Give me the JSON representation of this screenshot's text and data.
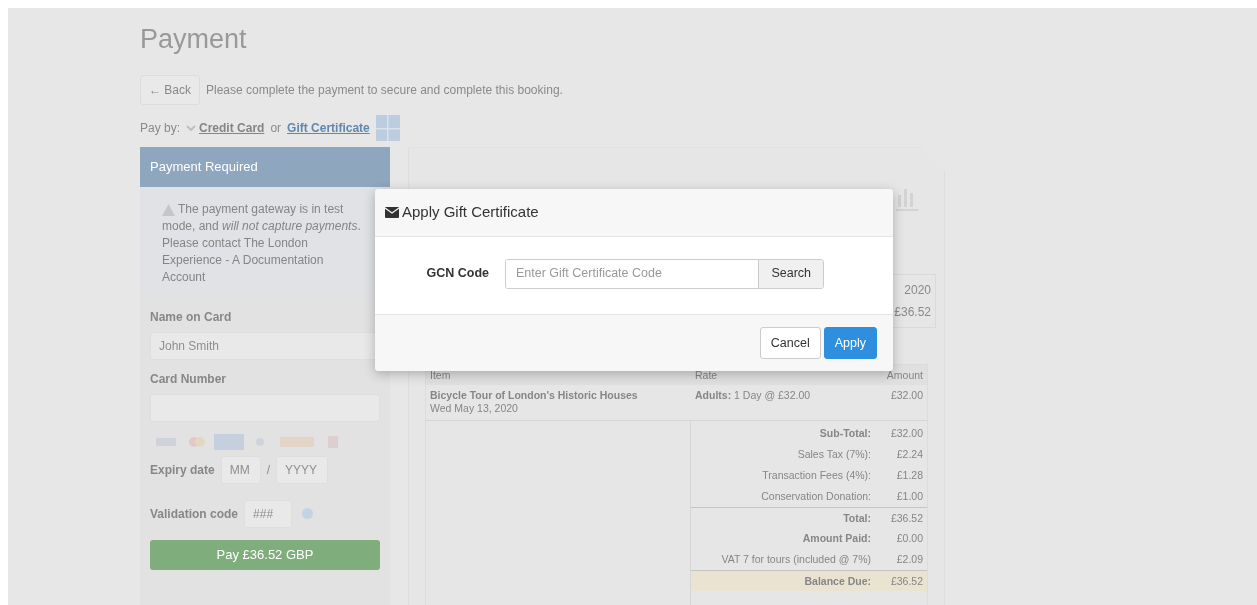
{
  "page": {
    "title": "Payment",
    "back_button": "← Back",
    "intro": "Please complete the payment to secure and complete this booking."
  },
  "pay_by": {
    "label": "Pay by:",
    "separator": "or",
    "options": [
      {
        "label": "Credit Card",
        "selected": true
      },
      {
        "label": "Gift Certificate",
        "selected": false
      }
    ]
  },
  "payment_panel": {
    "header": "Payment Required",
    "notice": "The payment gateway is in test mode, and *will not capture payments*. Please contact The London Experience - A Documentation Account",
    "name_on_card": {
      "label": "Name on Card",
      "placeholder": "John Smith"
    },
    "card_number": {
      "label": "Card Number"
    },
    "expiry": {
      "label": "Expiry date",
      "month_placeholder": "MM",
      "separator": "/",
      "year_placeholder": "YYYY"
    },
    "validation": {
      "label": "Validation code",
      "placeholder": "###"
    },
    "pay_button": "Pay £36.52 GBP"
  },
  "invoice": {
    "meta": [
      "2020",
      "£36.52"
    ],
    "table": {
      "columns": [
        "Item",
        "Rate",
        "Amount"
      ],
      "rows": [
        {
          "item": "Bicycle Tour of London's Historic Houses",
          "date": "Wed May 13, 2020",
          "rate_label": "Adults:",
          "rate": "1 Day @ £32.00",
          "amount": "£32.00"
        }
      ]
    },
    "totals": [
      {
        "label": "Sub-Total:",
        "value": "£32.00",
        "bold": true,
        "divider_before": false,
        "highlight": false
      },
      {
        "label": "Sales Tax (7%):",
        "value": "£2.24",
        "bold": false,
        "divider_before": false,
        "highlight": false
      },
      {
        "label": "Transaction Fees (4%):",
        "value": "£1.28",
        "bold": false,
        "divider_before": false,
        "highlight": false
      },
      {
        "label": "Conservation Donation:",
        "value": "£1.00",
        "bold": false,
        "divider_before": false,
        "highlight": false
      },
      {
        "label": "Total:",
        "value": "£36.52",
        "bold": true,
        "divider_before": true,
        "highlight": false
      },
      {
        "label": "Amount Paid:",
        "value": "£0.00",
        "bold": true,
        "divider_before": false,
        "highlight": false
      },
      {
        "label": "VAT 7 for tours (included @ 7%)",
        "value": "£2.09",
        "bold": false,
        "divider_before": false,
        "highlight": false
      },
      {
        "label": "Balance Due:",
        "value": "£36.52",
        "bold": true,
        "divider_before": true,
        "highlight": true
      }
    ]
  },
  "modal": {
    "title": "Apply Gift Certificate",
    "field_label": "GCN Code",
    "placeholder": "Enter Gift Certificate Code",
    "search_button": "Search",
    "buttons": [
      {
        "label": "Cancel",
        "kind": "secondary"
      },
      {
        "label": "Apply",
        "kind": "primary"
      }
    ]
  }
}
